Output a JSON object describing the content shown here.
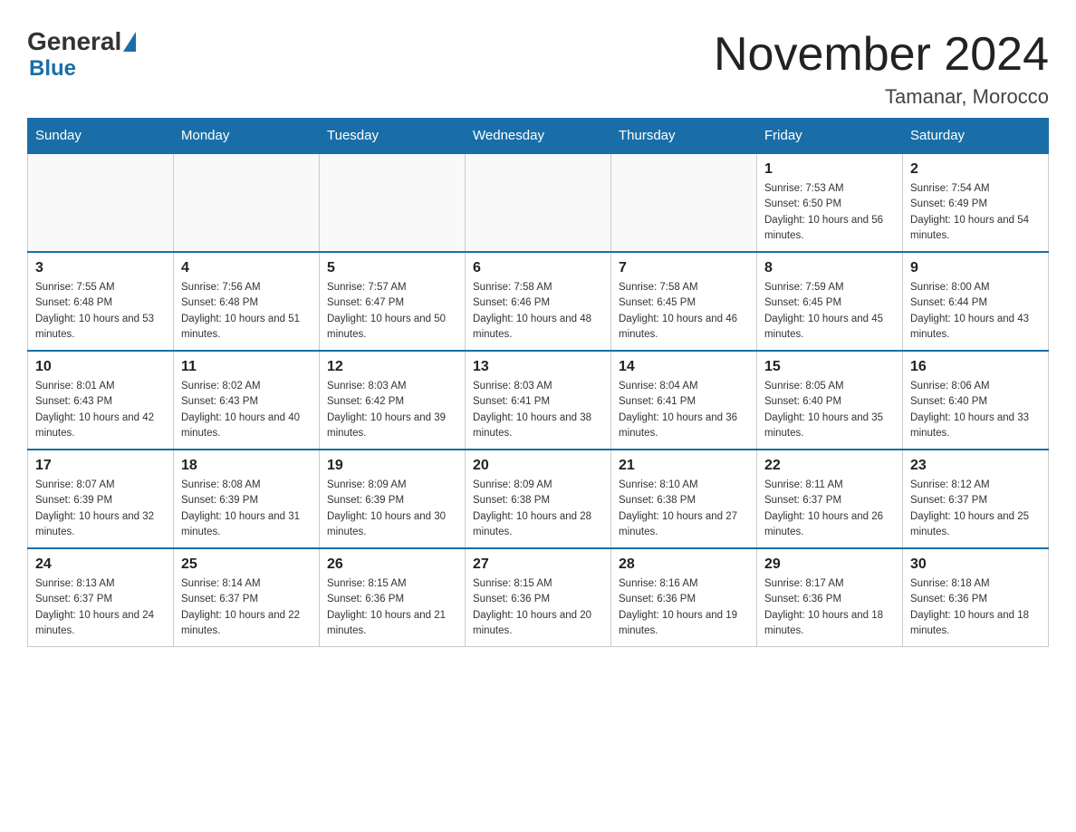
{
  "header": {
    "logo_general": "General",
    "logo_blue": "Blue",
    "month_title": "November 2024",
    "location": "Tamanar, Morocco"
  },
  "days_of_week": [
    "Sunday",
    "Monday",
    "Tuesday",
    "Wednesday",
    "Thursday",
    "Friday",
    "Saturday"
  ],
  "weeks": [
    [
      {
        "day": "",
        "info": ""
      },
      {
        "day": "",
        "info": ""
      },
      {
        "day": "",
        "info": ""
      },
      {
        "day": "",
        "info": ""
      },
      {
        "day": "",
        "info": ""
      },
      {
        "day": "1",
        "info": "Sunrise: 7:53 AM\nSunset: 6:50 PM\nDaylight: 10 hours and 56 minutes."
      },
      {
        "day": "2",
        "info": "Sunrise: 7:54 AM\nSunset: 6:49 PM\nDaylight: 10 hours and 54 minutes."
      }
    ],
    [
      {
        "day": "3",
        "info": "Sunrise: 7:55 AM\nSunset: 6:48 PM\nDaylight: 10 hours and 53 minutes."
      },
      {
        "day": "4",
        "info": "Sunrise: 7:56 AM\nSunset: 6:48 PM\nDaylight: 10 hours and 51 minutes."
      },
      {
        "day": "5",
        "info": "Sunrise: 7:57 AM\nSunset: 6:47 PM\nDaylight: 10 hours and 50 minutes."
      },
      {
        "day": "6",
        "info": "Sunrise: 7:58 AM\nSunset: 6:46 PM\nDaylight: 10 hours and 48 minutes."
      },
      {
        "day": "7",
        "info": "Sunrise: 7:58 AM\nSunset: 6:45 PM\nDaylight: 10 hours and 46 minutes."
      },
      {
        "day": "8",
        "info": "Sunrise: 7:59 AM\nSunset: 6:45 PM\nDaylight: 10 hours and 45 minutes."
      },
      {
        "day": "9",
        "info": "Sunrise: 8:00 AM\nSunset: 6:44 PM\nDaylight: 10 hours and 43 minutes."
      }
    ],
    [
      {
        "day": "10",
        "info": "Sunrise: 8:01 AM\nSunset: 6:43 PM\nDaylight: 10 hours and 42 minutes."
      },
      {
        "day": "11",
        "info": "Sunrise: 8:02 AM\nSunset: 6:43 PM\nDaylight: 10 hours and 40 minutes."
      },
      {
        "day": "12",
        "info": "Sunrise: 8:03 AM\nSunset: 6:42 PM\nDaylight: 10 hours and 39 minutes."
      },
      {
        "day": "13",
        "info": "Sunrise: 8:03 AM\nSunset: 6:41 PM\nDaylight: 10 hours and 38 minutes."
      },
      {
        "day": "14",
        "info": "Sunrise: 8:04 AM\nSunset: 6:41 PM\nDaylight: 10 hours and 36 minutes."
      },
      {
        "day": "15",
        "info": "Sunrise: 8:05 AM\nSunset: 6:40 PM\nDaylight: 10 hours and 35 minutes."
      },
      {
        "day": "16",
        "info": "Sunrise: 8:06 AM\nSunset: 6:40 PM\nDaylight: 10 hours and 33 minutes."
      }
    ],
    [
      {
        "day": "17",
        "info": "Sunrise: 8:07 AM\nSunset: 6:39 PM\nDaylight: 10 hours and 32 minutes."
      },
      {
        "day": "18",
        "info": "Sunrise: 8:08 AM\nSunset: 6:39 PM\nDaylight: 10 hours and 31 minutes."
      },
      {
        "day": "19",
        "info": "Sunrise: 8:09 AM\nSunset: 6:39 PM\nDaylight: 10 hours and 30 minutes."
      },
      {
        "day": "20",
        "info": "Sunrise: 8:09 AM\nSunset: 6:38 PM\nDaylight: 10 hours and 28 minutes."
      },
      {
        "day": "21",
        "info": "Sunrise: 8:10 AM\nSunset: 6:38 PM\nDaylight: 10 hours and 27 minutes."
      },
      {
        "day": "22",
        "info": "Sunrise: 8:11 AM\nSunset: 6:37 PM\nDaylight: 10 hours and 26 minutes."
      },
      {
        "day": "23",
        "info": "Sunrise: 8:12 AM\nSunset: 6:37 PM\nDaylight: 10 hours and 25 minutes."
      }
    ],
    [
      {
        "day": "24",
        "info": "Sunrise: 8:13 AM\nSunset: 6:37 PM\nDaylight: 10 hours and 24 minutes."
      },
      {
        "day": "25",
        "info": "Sunrise: 8:14 AM\nSunset: 6:37 PM\nDaylight: 10 hours and 22 minutes."
      },
      {
        "day": "26",
        "info": "Sunrise: 8:15 AM\nSunset: 6:36 PM\nDaylight: 10 hours and 21 minutes."
      },
      {
        "day": "27",
        "info": "Sunrise: 8:15 AM\nSunset: 6:36 PM\nDaylight: 10 hours and 20 minutes."
      },
      {
        "day": "28",
        "info": "Sunrise: 8:16 AM\nSunset: 6:36 PM\nDaylight: 10 hours and 19 minutes."
      },
      {
        "day": "29",
        "info": "Sunrise: 8:17 AM\nSunset: 6:36 PM\nDaylight: 10 hours and 18 minutes."
      },
      {
        "day": "30",
        "info": "Sunrise: 8:18 AM\nSunset: 6:36 PM\nDaylight: 10 hours and 18 minutes."
      }
    ]
  ]
}
